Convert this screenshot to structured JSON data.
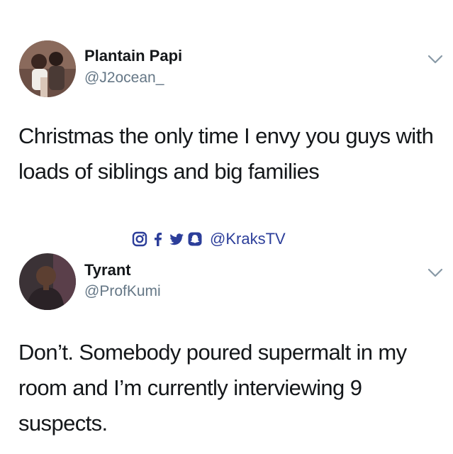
{
  "tweets": [
    {
      "author_name": "Plantain Papi",
      "author_handle": "@J2ocean_",
      "text": "Christmas the only time I envy you guys with loads of siblings and big families"
    },
    {
      "author_name": "Tyrant",
      "author_handle": "@ProfKumi",
      "text": "Don’t. Somebody poured supermalt in my room and I’m currently interviewing 9 suspects."
    }
  ],
  "watermark": {
    "icons": [
      "instagram-icon",
      "facebook-icon",
      "twitter-icon",
      "snapchat-icon"
    ],
    "handle": "@KraksTV",
    "color": "#2c3e9a"
  },
  "colors": {
    "text": "#14171a",
    "muted": "#657786",
    "chevron": "#8899a6"
  }
}
